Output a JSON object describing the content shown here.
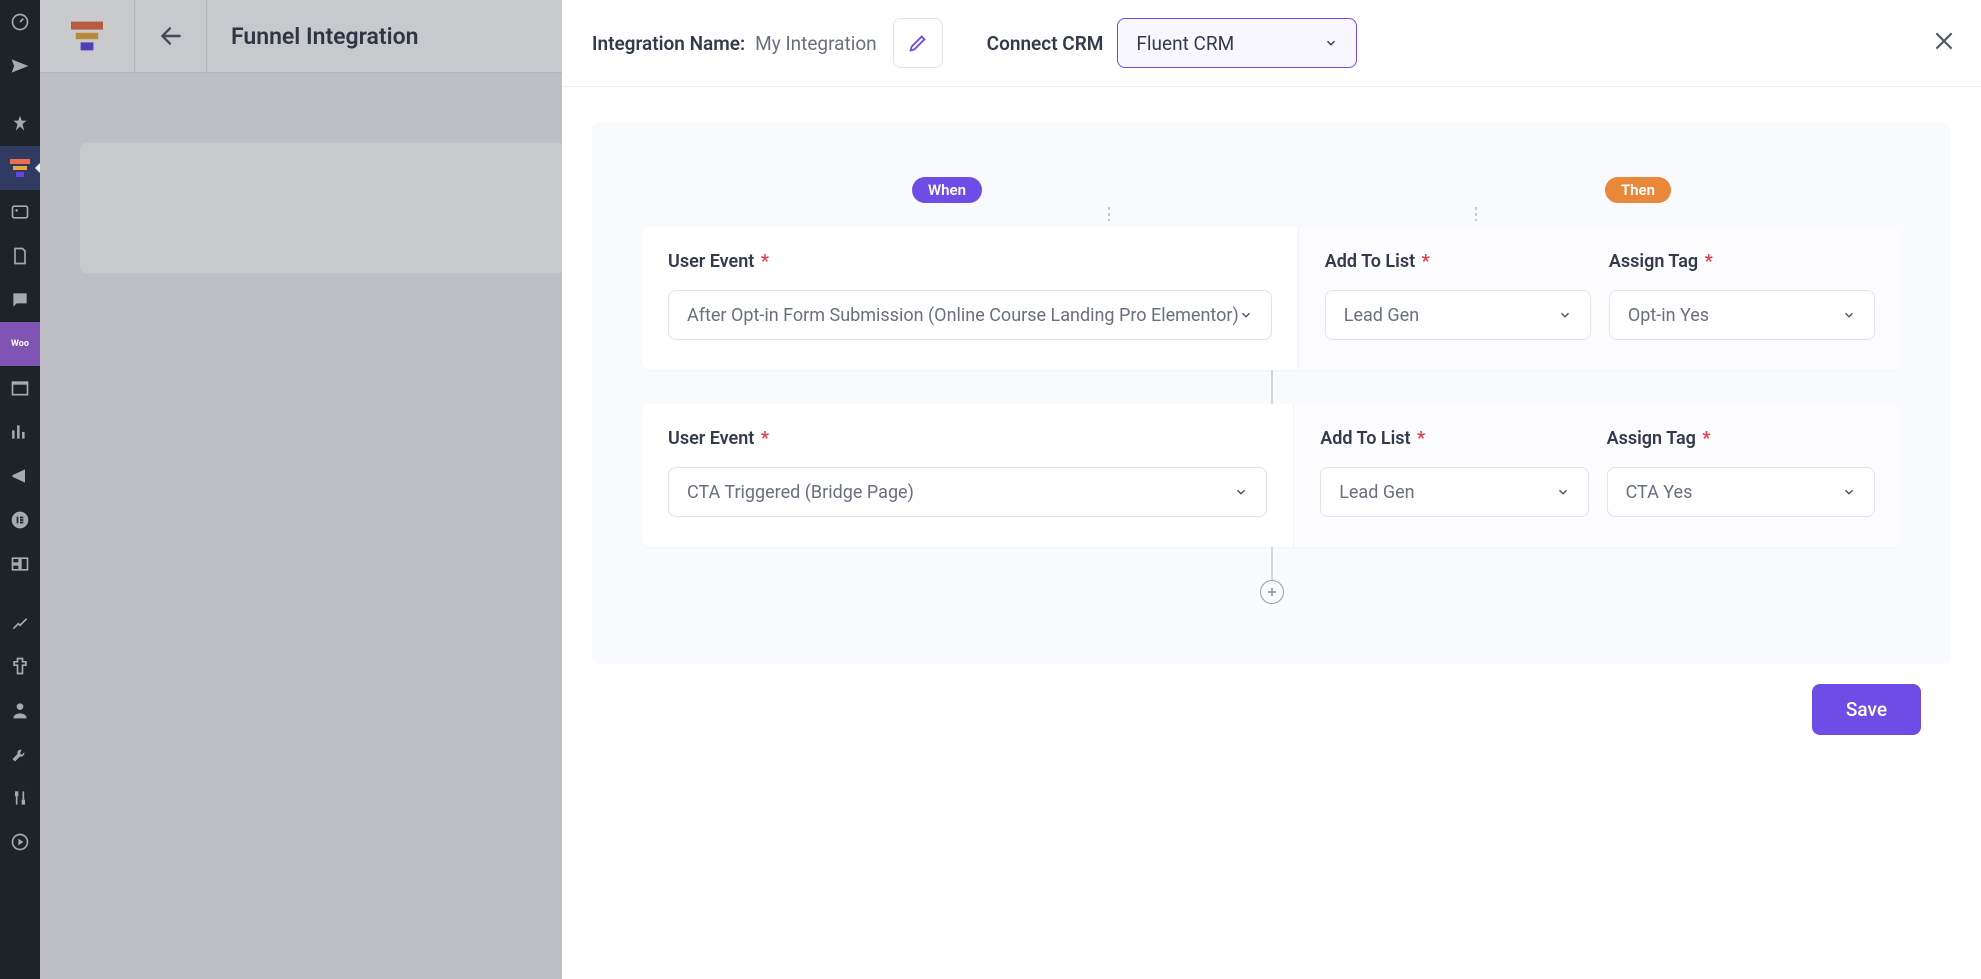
{
  "page_title": "Funnel Integration",
  "panel": {
    "integration_name_label": "Integration Name:",
    "integration_name_value": "My Integration",
    "connect_crm_label": "Connect CRM",
    "connect_crm_value": "Fluent CRM"
  },
  "pills": {
    "when": "When",
    "then": "Then"
  },
  "labels": {
    "user_event": "User Event",
    "add_to_list": "Add To List",
    "assign_tag": "Assign Tag",
    "required": "*"
  },
  "rules": [
    {
      "event": "After Opt-in Form Submission (Online Course Landing Pro Elementor)",
      "list": "Lead Gen",
      "tag": "Opt-in Yes"
    },
    {
      "event": "CTA Triggered (Bridge Page)",
      "list": "Lead Gen",
      "tag": "CTA Yes"
    }
  ],
  "save_label": "Save"
}
